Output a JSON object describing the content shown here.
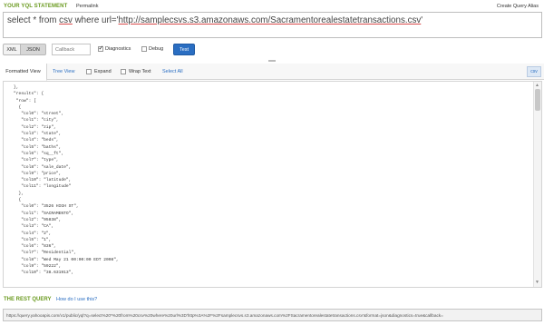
{
  "header": {
    "title": "YOUR YQL STATEMENT",
    "permalink": "Permalink",
    "create_alias": "Create Query Alias"
  },
  "query": {
    "prefix": "select * from ",
    "csv": "csv",
    "mid": " where url='",
    "url": "http://samplecsvs.s3.amazonaws.com/Sacramentorealestatetransactions.csv",
    "suffix": "'"
  },
  "controls": {
    "xml_label": "XML",
    "json_label": "JSON",
    "format_selected": "JSON",
    "callback_placeholder": "Callback",
    "diagnostics_label": "Diagnostics",
    "diagnostics_checked": true,
    "debug_label": "Debug",
    "debug_checked": false,
    "test_label": "Test"
  },
  "tabs": {
    "formatted": "Formatted View",
    "tree": "Tree View",
    "expand": "Expand",
    "wrap": "Wrap Text",
    "select_all": "Select All",
    "csv": "csv"
  },
  "output_lines": [
    "    },",
    "    \"results\": {",
    "     \"row\": [",
    "      {",
    "       \"col0\": \"street\",",
    "       \"col1\": \"city\",",
    "       \"col2\": \"zip\",",
    "       \"col3\": \"state\",",
    "       \"col4\": \"beds\",",
    "       \"col5\": \"baths\",",
    "       \"col6\": \"sq__ft\",",
    "       \"col7\": \"type\",",
    "       \"col8\": \"sale_date\",",
    "       \"col9\": \"price\",",
    "       \"col10\": \"latitude\",",
    "       \"col11\": \"longitude\"",
    "      },",
    "      {",
    "       \"col0\": \"3526 HIGH ST\",",
    "       \"col1\": \"SACRAMENTO\",",
    "       \"col2\": \"95838\",",
    "       \"col3\": \"CA\",",
    "       \"col4\": \"2\",",
    "       \"col5\": \"1\",",
    "       \"col6\": \"836\",",
    "       \"col7\": \"Residential\",",
    "       \"col8\": \"Wed May 21 00:00:00 EDT 2008\",",
    "       \"col9\": \"59222\",",
    "       \"col10\": \"38.631913\","
  ],
  "rest": {
    "title": "THE REST QUERY",
    "help_link": "How do I use this?",
    "url": "https://query.yahooapis.com/v1/public/yql?q=select%20*%20from%20csv%20where%20url%3D'http%3A%2F%2Fsamplecsvs.s3.amazonaws.com%2FSacramentorealestatetransactions.csv'&format=json&diagnostics=true&callback="
  }
}
